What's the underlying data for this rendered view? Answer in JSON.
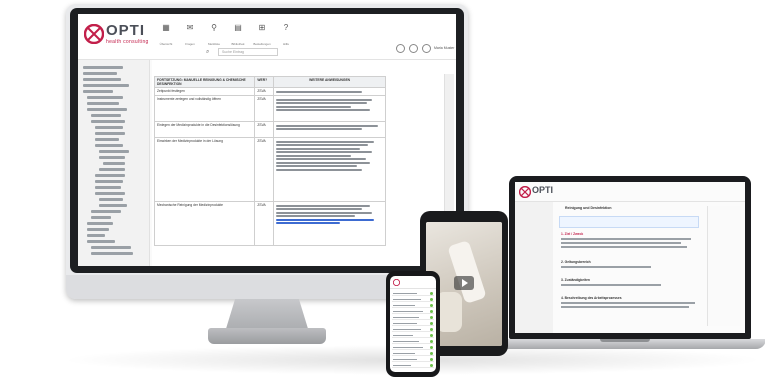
{
  "brand": {
    "name": "OPTI",
    "tagline": "health consulting",
    "accent": "#c21f4a",
    "mark_color": "#c21f4a"
  },
  "desktop": {
    "nav": [
      {
        "icon": "grid-icon",
        "label": "Übersicht"
      },
      {
        "icon": "chat-icon",
        "label": "Fragen"
      },
      {
        "icon": "pin-icon",
        "label": "Merkliste"
      },
      {
        "icon": "book-icon",
        "label": "Bibliothek"
      },
      {
        "icon": "cart-icon",
        "label": "Bestellungen"
      },
      {
        "icon": "help-icon",
        "label": "Hilfe"
      }
    ],
    "search_placeholder": "Suche Eintrag",
    "user_name": "Maria Muster",
    "table_header": {
      "col1": "FORTSETZUNG: MANUELLE REINIGUNG & CHEMISCHE DESINFEKTION",
      "col2": "WER?",
      "col3": "WEITERE ANWEISUNGEN"
    },
    "rows": [
      {
        "step": "Zeitpunkt festlegen",
        "who": "ZSVA"
      },
      {
        "step": "Instrumente zerlegen und vollständig öffnen",
        "who": "ZSVA"
      },
      {
        "step": "Einlegen der Medizinprodukte in die Desinfektionslösung",
        "who": "ZSVA"
      },
      {
        "step": "Einwirken der Medizinprodukte in der Lösung",
        "who": "ZSVA"
      },
      {
        "step": "Mechanische Reinigung der Medizinprodukte",
        "who": "ZSVA"
      }
    ]
  },
  "laptop": {
    "headline": "Reinigung und Desinfektion",
    "section1": "1. Ziel / Zweck",
    "section2": "2. Geltungsbereich",
    "section3": "3. Zuständigkeiten",
    "section4": "4. Beschreibung des Arbeitsprozesses"
  },
  "tablet": {
    "play_icon": "play-icon"
  },
  "phone": {
    "rows": 13
  }
}
